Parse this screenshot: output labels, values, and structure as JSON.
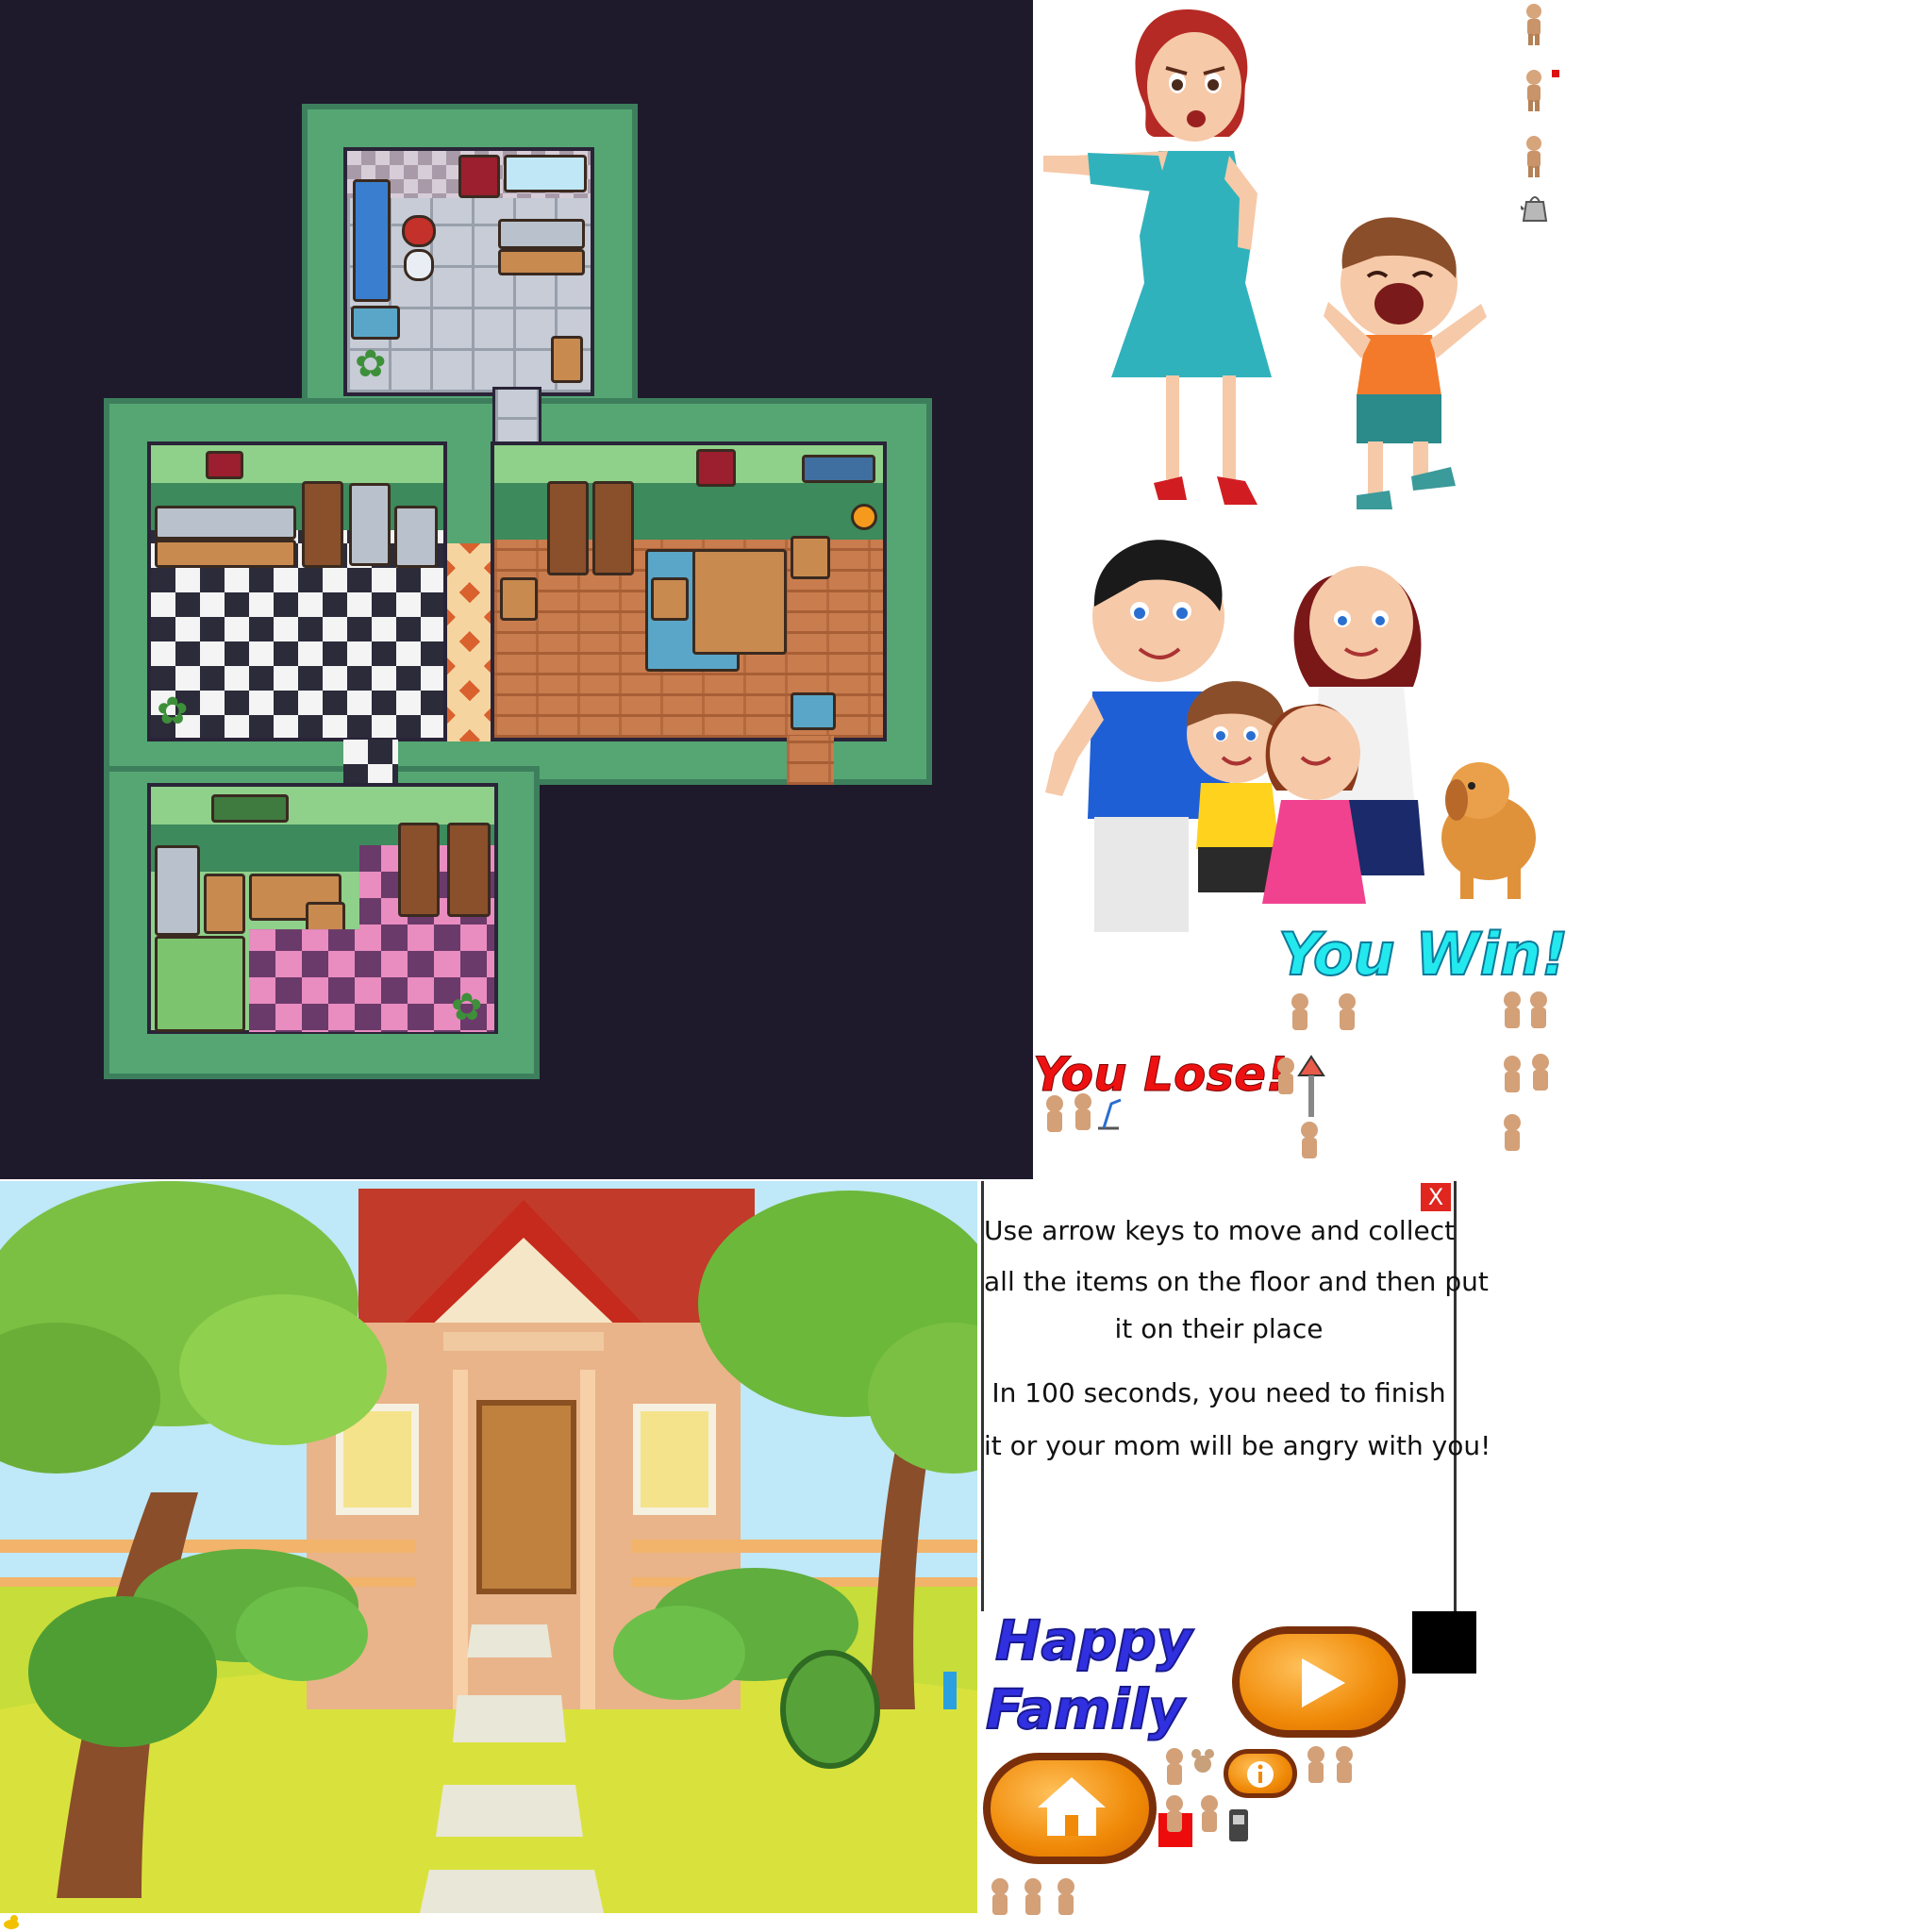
{
  "texts": {
    "you_win": "You Win!",
    "you_lose": "You Lose!",
    "title_line1": "Happy",
    "title_line2": "Family",
    "close_label": "X"
  },
  "instructions": {
    "lines": [
      "Use arrow keys to move and collect",
      "all the items on the floor and then put",
      "it on their place",
      "In 100 seconds, you need to finish",
      "it or your mom will be angry with you!"
    ]
  },
  "buttons": {
    "play": "play-icon",
    "home": "home-icon",
    "info": "info-icon"
  },
  "colors": {
    "you_win": "#23e8ee",
    "you_lose": "#ee1111",
    "title": "#3030e0",
    "button_orange": "#f08a08",
    "button_border": "#7a2f0b",
    "map_background": "#1e1a2c"
  },
  "icons": [
    "play-icon",
    "home-icon",
    "info-icon",
    "close-icon",
    "kettle-icon",
    "lamp-icon",
    "arrow-up-icon",
    "teddy-bear-icon",
    "trash-can-icon"
  ]
}
